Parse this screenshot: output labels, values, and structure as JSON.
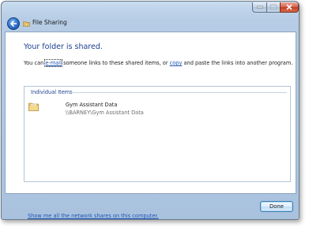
{
  "window": {
    "title": "File Sharing"
  },
  "icons": {
    "back": "back-arrow-icon",
    "title": "file-sharing-folder-icon",
    "minimize": "minimize-icon",
    "maximize": "maximize-icon",
    "close": "close-icon",
    "item": "shared-folder-icon"
  },
  "content": {
    "heading": "Your folder is shared.",
    "instruction": {
      "before_email": "You can ",
      "email_link": "e-mail",
      "middle": " someone links to these shared items, or ",
      "copy_link": "copy",
      "after_copy": " and paste the links into another program."
    },
    "items_header": "Individual Items",
    "items": [
      {
        "name": "Gym Assistant Data",
        "path": "\\\\BARNEY\\Gym Assistant Data"
      }
    ],
    "network_shares_link": "Show me all the network shares on this computer."
  },
  "buttons": {
    "done": "Done"
  },
  "colors": {
    "heading": "#1b3f91",
    "link": "#1f55b4",
    "close_button": "#c13f22"
  }
}
